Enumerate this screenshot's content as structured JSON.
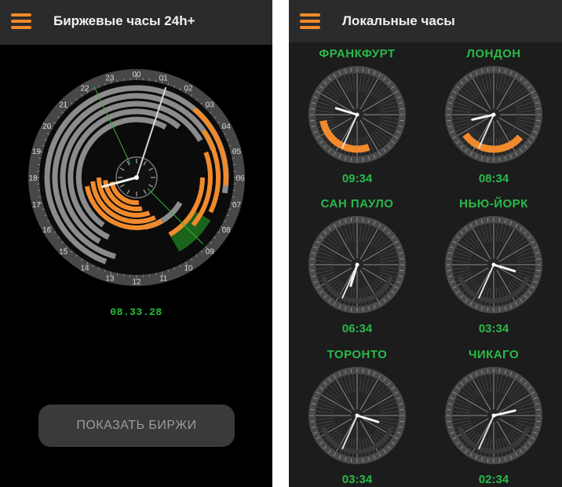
{
  "colors": {
    "accent": "#f08a2c",
    "digital_green": "#22c23a",
    "label_green": "#2ab94a",
    "left_background": "#000000",
    "right_background": "#1c1c1c",
    "bar_background": "#2b2b2b"
  },
  "left": {
    "menu_icon": "hamburger-menu-icon",
    "title": "Биржевые часы 24h+",
    "clock": {
      "hour_labels": [
        "20",
        "21",
        "22",
        "23",
        "00",
        "01",
        "02",
        "03",
        "04",
        "05",
        "06",
        "07",
        "08",
        "09",
        "10",
        "11",
        "12",
        "13",
        "14",
        "15",
        "16",
        "17",
        "18",
        "19"
      ],
      "hands": {
        "hour": 8.5,
        "minute": 33
      }
    },
    "digital_time": "08.33.28",
    "show_button_label": "ПОКАЗАТЬ БИРЖИ"
  },
  "right": {
    "menu_icon": "hamburger-menu-icon",
    "title": "Локальные часы",
    "cities": [
      {
        "name": "ФРАНКФУРТ",
        "time": "09:34",
        "hours": 9,
        "minutes": 34,
        "session": [
          160,
          260
        ]
      },
      {
        "name": "ЛОНДОН",
        "time": "08:34",
        "hours": 8,
        "minutes": 34,
        "session": [
          130,
          235
        ]
      },
      {
        "name": "САН ПАУЛО",
        "time": "06:34",
        "hours": 6,
        "minutes": 34,
        "session": null
      },
      {
        "name": "НЬЮ-ЙОРК",
        "time": "03:34",
        "hours": 3,
        "minutes": 34,
        "session": null
      },
      {
        "name": "ТОРОНТО",
        "time": "03:34",
        "hours": 3,
        "minutes": 34,
        "session": null
      },
      {
        "name": "ЧИКАГО",
        "time": "02:34",
        "hours": 2,
        "minutes": 34,
        "session": null
      }
    ]
  }
}
